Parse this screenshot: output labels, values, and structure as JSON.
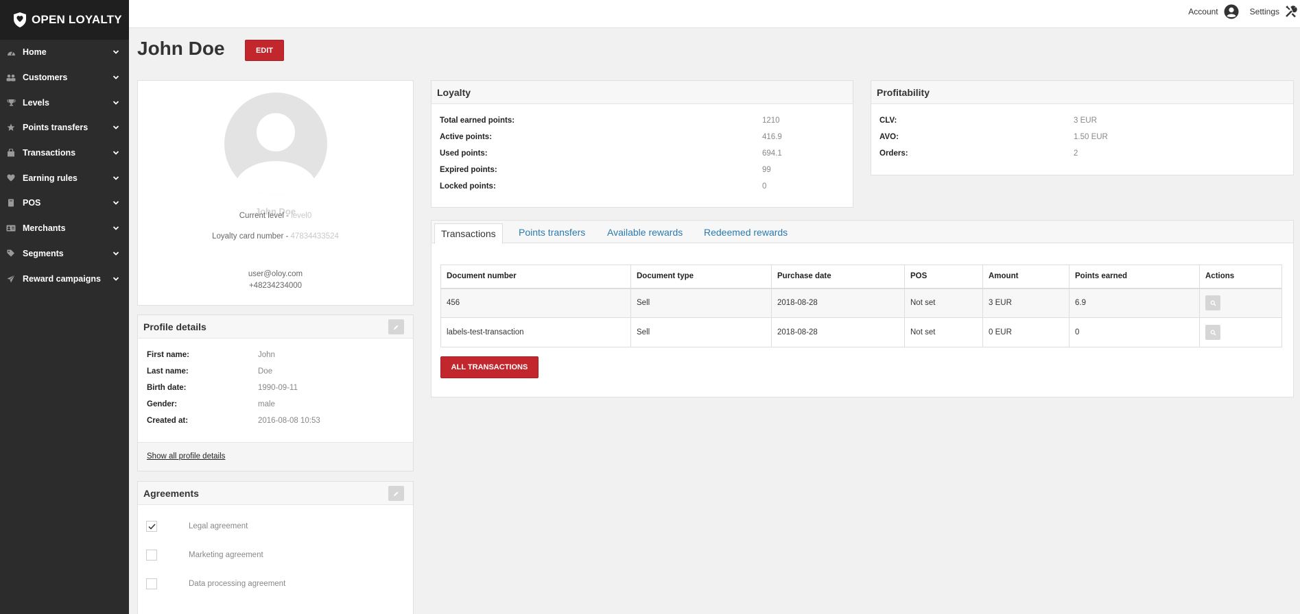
{
  "brand": {
    "name": "OPEN LOYALTY"
  },
  "sidebar": {
    "items": [
      {
        "label": "Home",
        "icon": "dashboard-icon"
      },
      {
        "label": "Customers",
        "icon": "users-icon"
      },
      {
        "label": "Levels",
        "icon": "trophy-icon"
      },
      {
        "label": "Points transfers",
        "icon": "star-icon"
      },
      {
        "label": "Transactions",
        "icon": "bag-icon"
      },
      {
        "label": "Earning rules",
        "icon": "heart-icon"
      },
      {
        "label": "POS",
        "icon": "book-icon"
      },
      {
        "label": "Merchants",
        "icon": "id-card-icon"
      },
      {
        "label": "Segments",
        "icon": "tags-icon"
      },
      {
        "label": "Reward campaigns",
        "icon": "paper-plane-icon"
      }
    ]
  },
  "topbar": {
    "account_label": "Account",
    "settings_label": "Settings"
  },
  "page": {
    "title": "John Doe",
    "edit_label": "EDIT"
  },
  "profile": {
    "name": "John Doe",
    "level_label": "Current level - ",
    "level_value": "level0",
    "card_label": "Loyalty card number - ",
    "card_value": "47834433524",
    "email": "user@oloy.com",
    "phone": "+48234234000"
  },
  "profile_details": {
    "title": "Profile details",
    "rows": [
      {
        "label": "First name:",
        "value": "John"
      },
      {
        "label": "Last name:",
        "value": "Doe"
      },
      {
        "label": "Birth date:",
        "value": "1990-09-11"
      },
      {
        "label": "Gender:",
        "value": "male"
      },
      {
        "label": "Created at:",
        "value": "2016-08-08 10:53"
      }
    ],
    "show_all_label": "Show all profile details"
  },
  "agreements": {
    "title": "Agreements",
    "items": [
      {
        "label": "Legal agreement",
        "checked": true
      },
      {
        "label": "Marketing agreement",
        "checked": false
      },
      {
        "label": "Data processing agreement",
        "checked": false
      }
    ]
  },
  "loyalty": {
    "title": "Loyalty",
    "rows": [
      {
        "label": "Total earned points:",
        "value": "1210"
      },
      {
        "label": "Active points:",
        "value": "416.9"
      },
      {
        "label": "Used points:",
        "value": "694.1"
      },
      {
        "label": "Expired points:",
        "value": "99"
      },
      {
        "label": "Locked points:",
        "value": "0"
      }
    ]
  },
  "profitability": {
    "title": "Profitability",
    "rows": [
      {
        "label": "CLV:",
        "value": "3 EUR"
      },
      {
        "label": "AVO:",
        "value": "1.50 EUR"
      },
      {
        "label": "Orders:",
        "value": "2"
      }
    ]
  },
  "tabs": [
    {
      "label": "Transactions",
      "active": true
    },
    {
      "label": "Points transfers",
      "active": false
    },
    {
      "label": "Available rewards",
      "active": false
    },
    {
      "label": "Redeemed rewards",
      "active": false
    }
  ],
  "transactions": {
    "columns": [
      "Document number",
      "Document type",
      "Purchase date",
      "POS",
      "Amount",
      "Points earned",
      "Actions"
    ],
    "rows": [
      [
        "456",
        "Sell",
        "2018-08-28",
        "Not set",
        "3 EUR",
        "6.9"
      ],
      [
        "labels-test-transaction",
        "Sell",
        "2018-08-28",
        "Not set",
        "0 EUR",
        "0"
      ]
    ],
    "all_label": "ALL TRANSACTIONS"
  },
  "colors": {
    "accent": "#c1272d",
    "sidebar": "#2c2c2c",
    "link": "#2a7ab0"
  }
}
